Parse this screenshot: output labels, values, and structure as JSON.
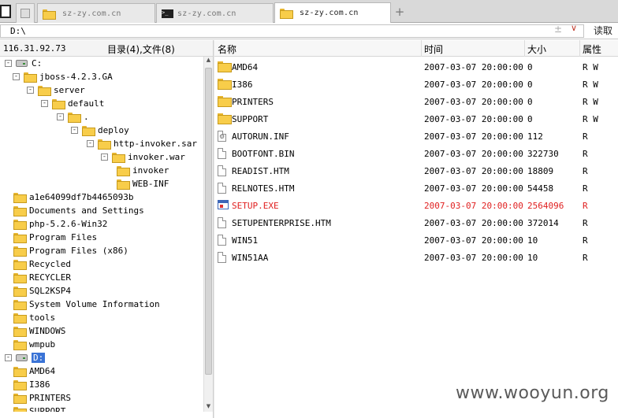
{
  "tabs": [
    {
      "label": "sz-zy.com.cn",
      "icon": "folder-icon",
      "active": false
    },
    {
      "label": "sz-zy.com.cn",
      "icon": "terminal-icon",
      "active": false
    },
    {
      "label": "sz-zy.com.cn",
      "icon": "folder-icon",
      "active": true
    }
  ],
  "address": {
    "path": "D:\\",
    "plus": "±",
    "chevron": "∨",
    "read_label": "读取"
  },
  "left": {
    "ip": "116.31.92.73",
    "count": "目录(4),文件(8)",
    "tree": [
      {
        "label": "C:",
        "type": "drive",
        "exp": "-"
      },
      {
        "label": "jboss-4.2.3.GA",
        "type": "folder",
        "exp": "-"
      },
      {
        "label": "server",
        "type": "folder",
        "exp": "-"
      },
      {
        "label": "default",
        "type": "folder",
        "exp": "-"
      },
      {
        "label": ".",
        "type": "folder",
        "exp": "-"
      },
      {
        "label": "deploy",
        "type": "folder",
        "exp": "-"
      },
      {
        "label": "http-invoker.sar",
        "type": "folder",
        "exp": "-"
      },
      {
        "label": "invoker.war",
        "type": "folder",
        "exp": "-"
      },
      {
        "label": "invoker",
        "type": "folder",
        "exp": ""
      },
      {
        "label": "WEB-INF",
        "type": "folder",
        "exp": ""
      },
      {
        "label": "a1e64099df7b4465093b",
        "type": "folder",
        "exp": ""
      },
      {
        "label": "Documents and Settings",
        "type": "folder",
        "exp": ""
      },
      {
        "label": "php-5.2.6-Win32",
        "type": "folder",
        "exp": ""
      },
      {
        "label": "Program Files",
        "type": "folder",
        "exp": ""
      },
      {
        "label": "Program Files (x86)",
        "type": "folder",
        "exp": ""
      },
      {
        "label": "Recycled",
        "type": "folder",
        "exp": ""
      },
      {
        "label": "RECYCLER",
        "type": "folder",
        "exp": ""
      },
      {
        "label": "SQL2KSP4",
        "type": "folder",
        "exp": ""
      },
      {
        "label": "System Volume Information",
        "type": "folder",
        "exp": ""
      },
      {
        "label": "tools",
        "type": "folder",
        "exp": ""
      },
      {
        "label": "WINDOWS",
        "type": "folder",
        "exp": ""
      },
      {
        "label": "wmpub",
        "type": "folder",
        "exp": ""
      },
      {
        "label": "D:",
        "type": "drive",
        "exp": "-",
        "selected": true
      },
      {
        "label": "AMD64",
        "type": "folder",
        "exp": ""
      },
      {
        "label": "I386",
        "type": "folder",
        "exp": ""
      },
      {
        "label": "PRINTERS",
        "type": "folder",
        "exp": ""
      },
      {
        "label": "SUPPORT",
        "type": "folder",
        "exp": ""
      }
    ]
  },
  "columns": {
    "name": "名称",
    "time": "时间",
    "size": "大小",
    "attr": "属性"
  },
  "files": [
    {
      "name": "AMD64",
      "time": "2007-03-07 20:00:00",
      "size": "0",
      "attr": "R W",
      "kind": "folder"
    },
    {
      "name": "I386",
      "time": "2007-03-07 20:00:00",
      "size": "0",
      "attr": "R W",
      "kind": "folder"
    },
    {
      "name": "PRINTERS",
      "time": "2007-03-07 20:00:00",
      "size": "0",
      "attr": "R W",
      "kind": "folder"
    },
    {
      "name": "SUPPORT",
      "time": "2007-03-07 20:00:00",
      "size": "0",
      "attr": "R W",
      "kind": "folder"
    },
    {
      "name": "AUTORUN.INF",
      "time": "2007-03-07 20:00:00",
      "size": "112",
      "attr": "R",
      "kind": "config"
    },
    {
      "name": "BOOTFONT.BIN",
      "time": "2007-03-07 20:00:00",
      "size": "322730",
      "attr": "R",
      "kind": "file"
    },
    {
      "name": "READIST.HTM",
      "time": "2007-03-07 20:00:00",
      "size": "18809",
      "attr": "R",
      "kind": "file"
    },
    {
      "name": "RELNOTES.HTM",
      "time": "2007-03-07 20:00:00",
      "size": "54458",
      "attr": "R",
      "kind": "file"
    },
    {
      "name": "SETUP.EXE",
      "time": "2007-03-07 20:00:00",
      "size": "2564096",
      "attr": "R",
      "kind": "exe",
      "highlight": true
    },
    {
      "name": "SETUPENTERPRISE.HTM",
      "time": "2007-03-07 20:00:00",
      "size": "372014",
      "attr": "R",
      "kind": "file"
    },
    {
      "name": "WIN51",
      "time": "2007-03-07 20:00:00",
      "size": "10",
      "attr": "R",
      "kind": "file"
    },
    {
      "name": "WIN51AA",
      "time": "2007-03-07 20:00:00",
      "size": "10",
      "attr": "R",
      "kind": "file"
    }
  ],
  "watermark": "www.wooyun.org",
  "colors": {
    "highlight": "#e02020",
    "selection": "#3a73d6",
    "folder": "#f8cd4a"
  }
}
